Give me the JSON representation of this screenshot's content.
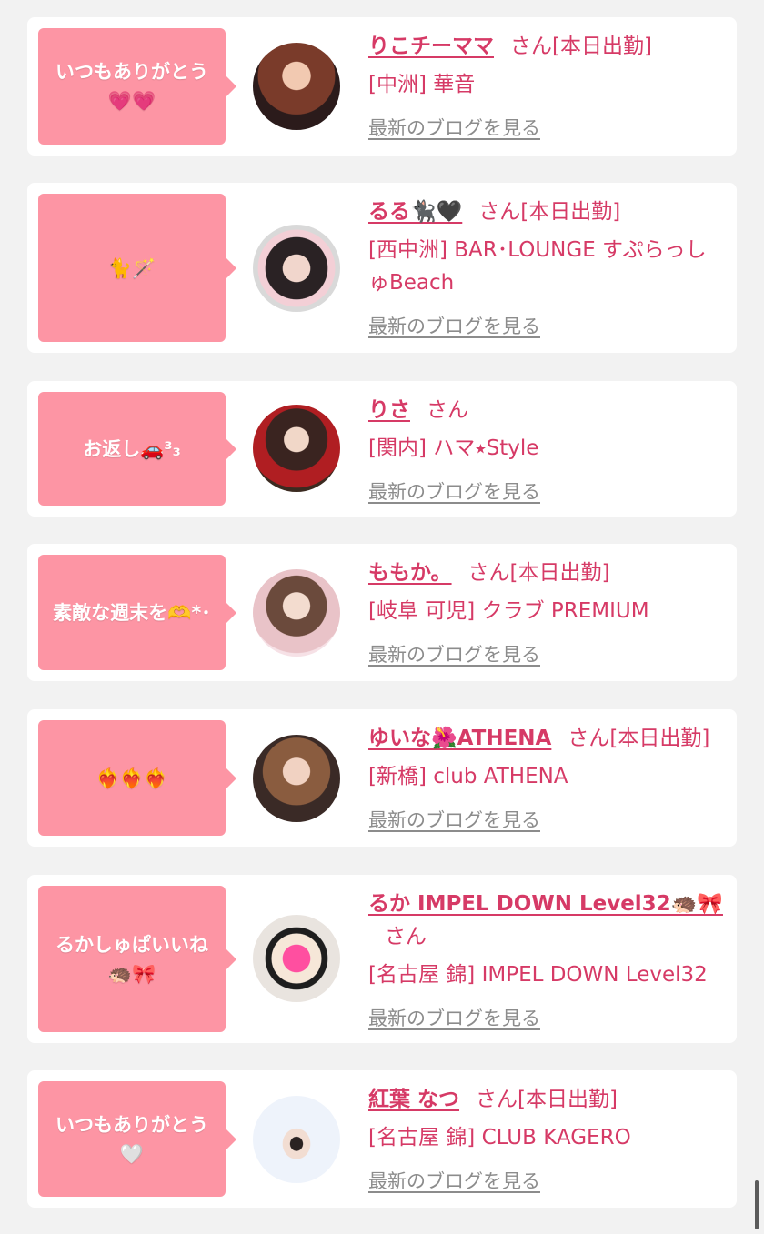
{
  "common": {
    "san": "さん",
    "blog_link": "最新のブログを見る"
  },
  "entries": [
    {
      "message": "いつもありがとう💗💗",
      "name": "りこチーママ",
      "status": "[本日出勤]",
      "shop": "[中洲] 華音"
    },
    {
      "message": "🐈🪄",
      "name": "るる🐈‍⬛🖤",
      "status": "[本日出勤]",
      "shop": "[西中洲] BAR･LOUNGE すぷらっしゅBeach"
    },
    {
      "message": "お返し🚗³₃",
      "name": "りさ",
      "status": "",
      "shop": "[関内] ハマ⭑Style"
    },
    {
      "message": "素敵な週末を🫶*･",
      "name": "ももか。",
      "status": "[本日出勤]",
      "shop": "[岐阜 可児] クラブ PREMIUM"
    },
    {
      "message": "❤️‍🔥❤️‍🔥❤️‍🔥",
      "name": "ゆいな🌺ATHENA",
      "status": "[本日出勤]",
      "shop": "[新橋] club ATHENA"
    },
    {
      "message": "るかしゅぱいいね🦔🎀",
      "name": "るか IMPEL DOWN Level32🦔🎀",
      "status": "",
      "shop": "[名古屋 錦] IMPEL DOWN Level32"
    },
    {
      "message": "いつもありがとう🤍",
      "name": "紅葉 なつ",
      "status": "[本日出勤]",
      "shop": "[名古屋 錦] CLUB KAGERO"
    }
  ],
  "colors": {
    "page_bg": "#f2f2f2",
    "card_bg": "#ffffff",
    "bubble_bg": "#fd95a4",
    "name_text": "#d63a66",
    "link_text": "#8c8c8c"
  },
  "icons": [
    "avatar-photo",
    "speech-bubble"
  ]
}
